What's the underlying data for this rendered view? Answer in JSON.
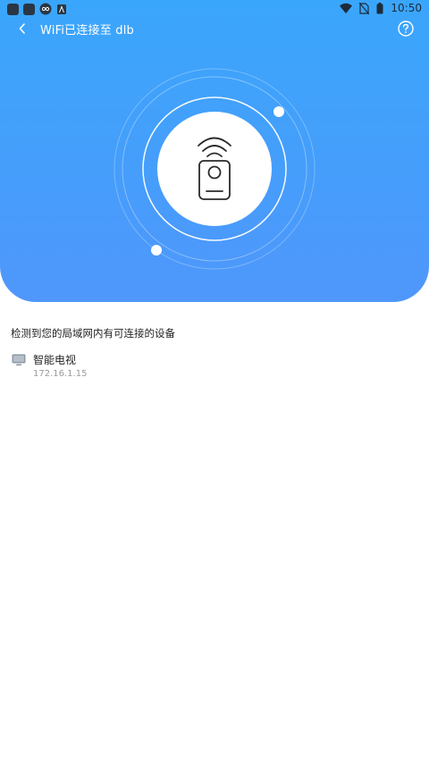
{
  "status_bar": {
    "time": "10:50",
    "icons": [
      "app-icon",
      "app-icon",
      "cat-icon",
      "a-icon",
      "wifi-icon",
      "no-sim-icon",
      "battery-icon"
    ]
  },
  "header": {
    "title": "WiFi已连接至 dlb",
    "back_icon": "chevron-left-icon",
    "help_icon": "help-circle-icon"
  },
  "colors": {
    "hero_top": "#3aa6fb",
    "hero_bottom": "#4f97fb",
    "white": "#ffffff"
  },
  "main": {
    "section_label": "检测到您的局域网内有可连接的设备",
    "devices": [
      {
        "name": "智能电视",
        "ip": "172.16.1.15",
        "icon": "tv-icon"
      }
    ]
  }
}
